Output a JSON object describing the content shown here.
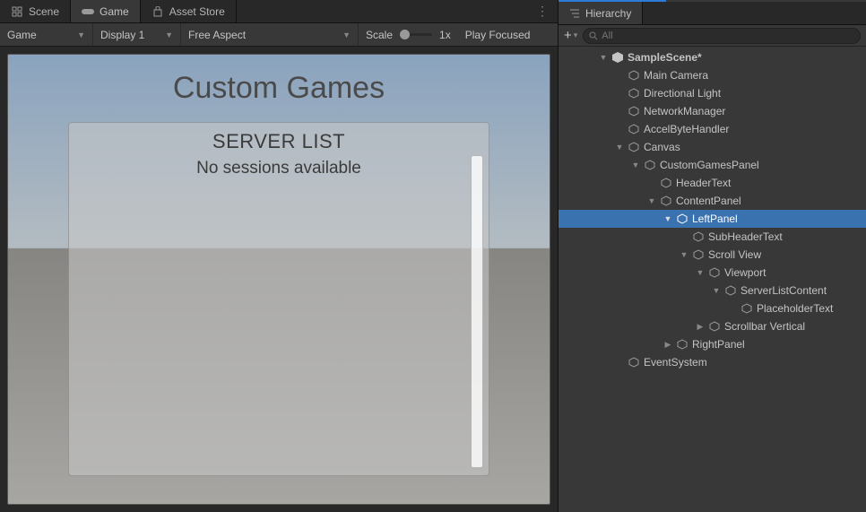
{
  "tabs": {
    "scene": "Scene",
    "game": "Game",
    "asset_store": "Asset Store"
  },
  "game_toolbar": {
    "output": "Game",
    "display": "Display 1",
    "aspect": "Free Aspect",
    "scale_label": "Scale",
    "scale_value": "1x",
    "play_focused": "Play Focused"
  },
  "game_view": {
    "title": "Custom Games",
    "server_list_header": "SERVER LIST",
    "empty_msg": "No sessions available"
  },
  "hierarchy": {
    "tab_label": "Hierarchy",
    "search_placeholder": "All",
    "scene_name": "SampleScene*",
    "nodes": {
      "main_camera": "Main Camera",
      "directional_light": "Directional Light",
      "network_manager": "NetworkManager",
      "accelbyte_handler": "AccelByteHandler",
      "canvas": "Canvas",
      "custom_games_panel": "CustomGamesPanel",
      "header_text": "HeaderText",
      "content_panel": "ContentPanel",
      "left_panel": "LeftPanel",
      "sub_header_text": "SubHeaderText",
      "scroll_view": "Scroll View",
      "viewport": "Viewport",
      "server_list_content": "ServerListContent",
      "placeholder_text": "PlaceholderText",
      "scrollbar_vertical": "Scrollbar Vertical",
      "right_panel": "RightPanel",
      "event_system": "EventSystem"
    }
  }
}
